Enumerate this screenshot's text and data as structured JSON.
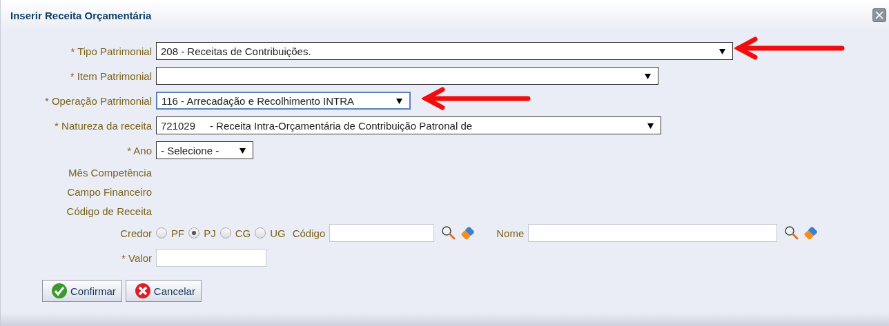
{
  "dialog": {
    "title": "Inserir Receita Orçamentária"
  },
  "selects": [
    {
      "label": "* Tipo Patrimonial",
      "value": "208 - Receitas de Contribuições.",
      "focused": false
    },
    {
      "label": "* Item Patrimonial",
      "focused": false
    },
    {
      "label": "* Operação Patrimonial",
      "value": "116 - Arrecadação e Recolhimento INTRA",
      "focused": true
    },
    {
      "label": "* Natureza da receita",
      "value": "721029     - Receita Intra-Orçamentária de Contribuição Patronal de",
      "focused": false
    },
    {
      "label": "* Ano",
      "value": "- Selecione -",
      "focused": false
    }
  ],
  "info_labels": [
    "Mês Competência",
    "Campo Financeiro",
    "Código de Receita"
  ],
  "credor": {
    "label": "Credor",
    "options": [
      {
        "label": "PF",
        "selected": false
      },
      {
        "label": "PJ",
        "selected": true
      },
      {
        "label": "CG",
        "selected": false
      },
      {
        "label": "UG",
        "selected": false
      }
    ],
    "codigo_label": "Código",
    "nome_label": "Nome"
  },
  "valor": {
    "label": "* Valor"
  },
  "buttons": [
    {
      "label": "Confirmar",
      "kind": "confirm"
    },
    {
      "label": "Cancelar",
      "kind": "cancel"
    }
  ]
}
